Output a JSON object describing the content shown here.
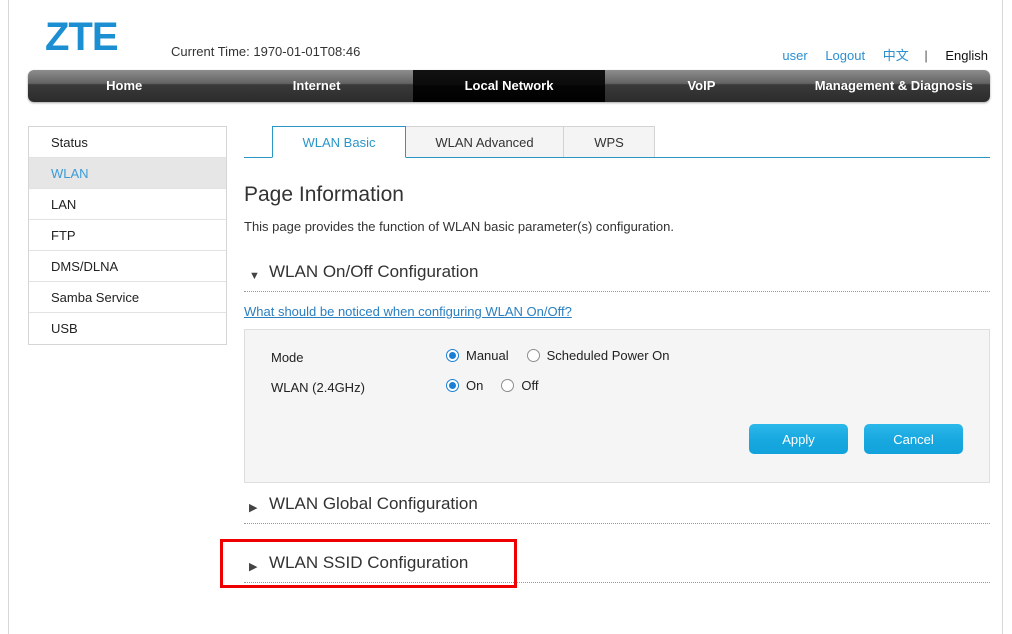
{
  "header": {
    "logo_text": "ZTE",
    "current_time_label": "Current Time: 1970-01-01T08:46",
    "user_link": "user",
    "logout_link": "Logout",
    "lang_chinese": "中文",
    "lang_separator": "|",
    "lang_english": "English",
    "accent_color": "#1b8fd1",
    "link_color": "#2b8fd0"
  },
  "navbar": {
    "items": [
      {
        "label": "Home",
        "active": false
      },
      {
        "label": "Internet",
        "active": false
      },
      {
        "label": "Local Network",
        "active": true
      },
      {
        "label": "VoIP",
        "active": false
      },
      {
        "label": "Management & Diagnosis",
        "active": false
      }
    ]
  },
  "sidebar": {
    "items": [
      {
        "label": "Status",
        "active": false
      },
      {
        "label": "WLAN",
        "active": true
      },
      {
        "label": "LAN",
        "active": false
      },
      {
        "label": "FTP",
        "active": false
      },
      {
        "label": "DMS/DLNA",
        "active": false
      },
      {
        "label": "Samba Service",
        "active": false
      },
      {
        "label": "USB",
        "active": false
      }
    ],
    "active_color": "#3b9bd6"
  },
  "tabs": [
    {
      "label": "WLAN Basic",
      "active": true
    },
    {
      "label": "WLAN Advanced",
      "active": false
    },
    {
      "label": "WPS",
      "active": false
    }
  ],
  "main": {
    "page_title": "Page Information",
    "page_description": "This page provides the function of WLAN basic parameter(s) configuration.",
    "tab_accent_color": "#2a96c8"
  },
  "onoff_section": {
    "arrow": "▼",
    "title": "WLAN On/Off Configuration",
    "help_link": "What should be noticed when configuring WLAN On/Off?",
    "fields": [
      {
        "label": "Mode",
        "options": [
          {
            "label": "Manual",
            "selected": true
          },
          {
            "label": "Scheduled Power On",
            "selected": false
          }
        ]
      },
      {
        "label": "WLAN (2.4GHz)",
        "options": [
          {
            "label": "On",
            "selected": true
          },
          {
            "label": "Off",
            "selected": false
          }
        ]
      }
    ],
    "apply_label": "Apply",
    "cancel_label": "Cancel",
    "button_color": "#19a9e0"
  },
  "global_section": {
    "arrow": "▶",
    "title": "WLAN Global Configuration"
  },
  "ssid_section": {
    "arrow": "▶",
    "title": "WLAN SSID Configuration",
    "highlighted": true,
    "highlight_color": "#ee0000"
  }
}
